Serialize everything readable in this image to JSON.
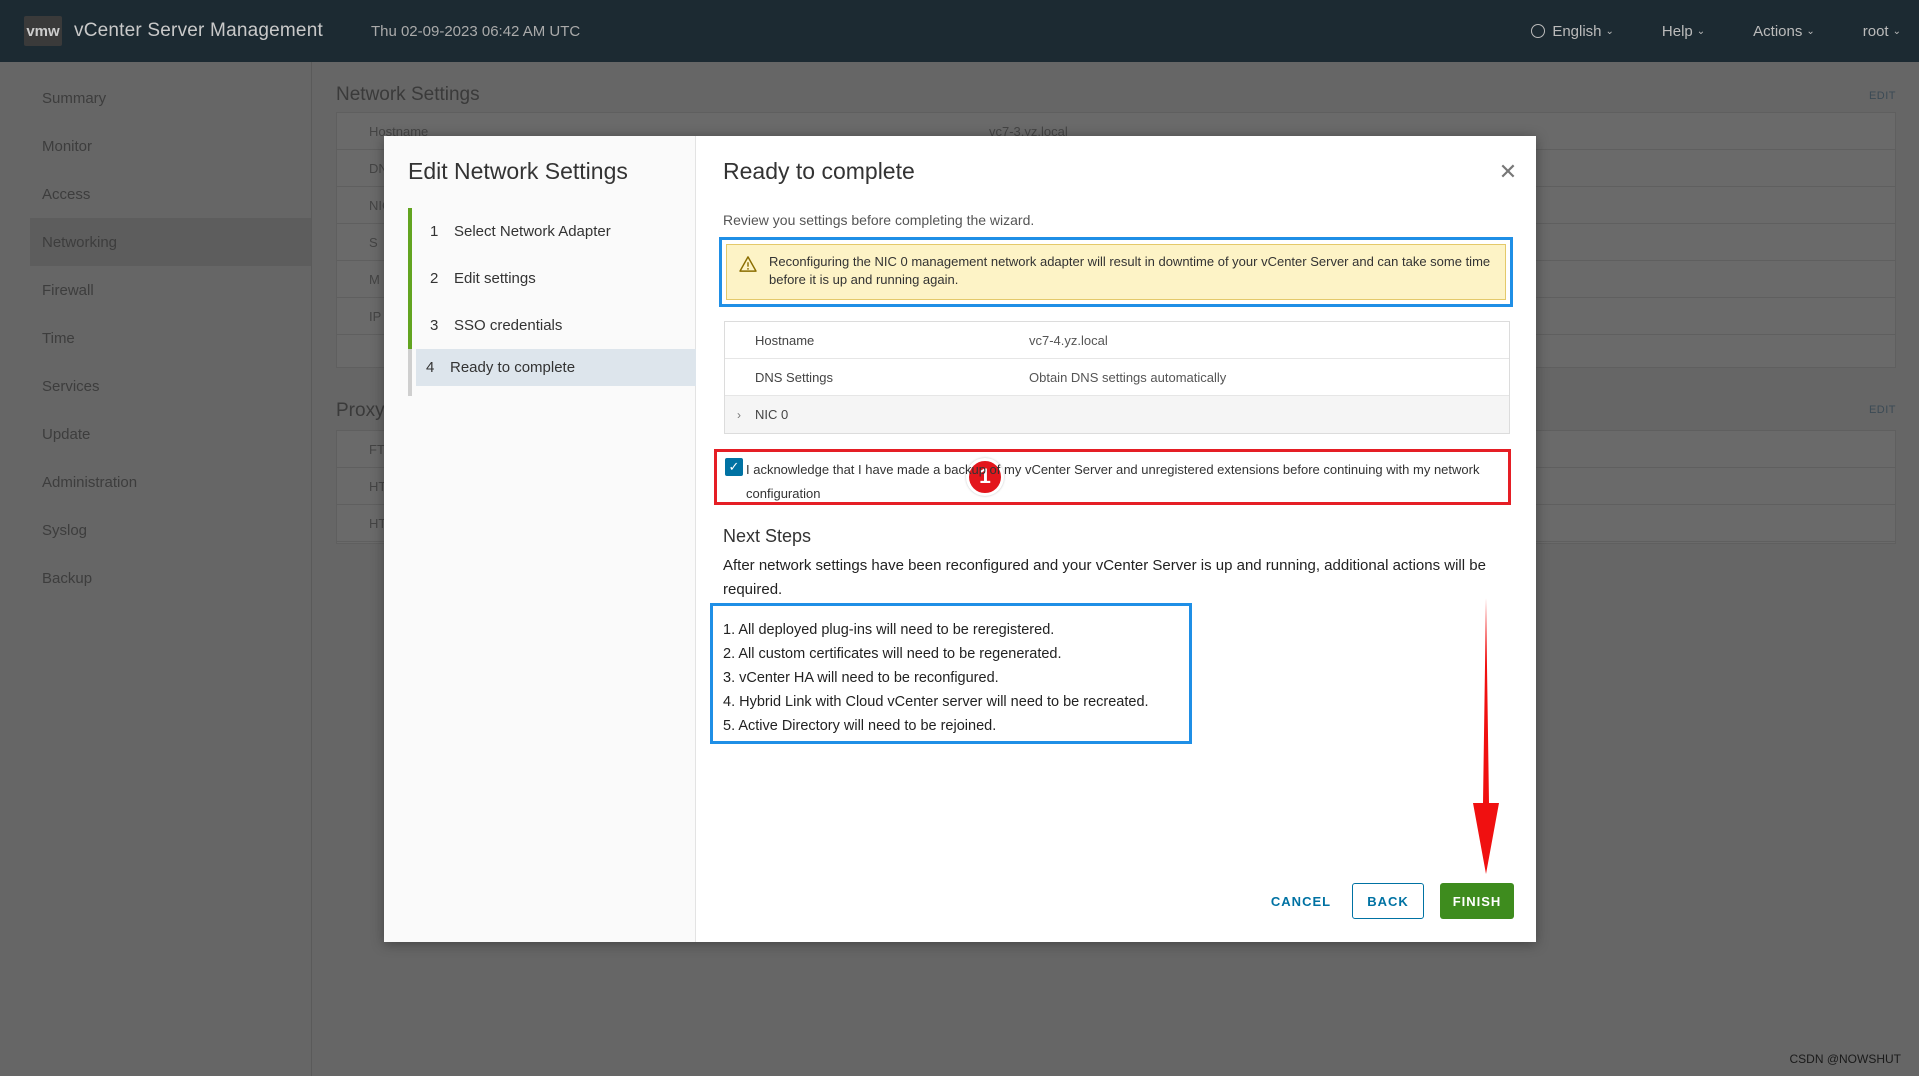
{
  "topbar": {
    "logo": "vmw",
    "title": "vCenter Server Management",
    "datetime": "Thu 02-09-2023 06:42 AM UTC",
    "language": "English",
    "help": "Help",
    "actions": "Actions",
    "user": "root"
  },
  "sidebar": {
    "items": [
      "Summary",
      "Monitor",
      "Access",
      "Networking",
      "Firewall",
      "Time",
      "Services",
      "Update",
      "Administration",
      "Syslog",
      "Backup"
    ],
    "active": "Networking"
  },
  "main": {
    "network_title": "Network Settings",
    "network_edit": "EDIT",
    "network_rows": [
      "Hostname",
      "DNS",
      "NIC",
      "S",
      "M",
      "IP",
      "IP"
    ],
    "network_hostname_value": "vc7-3.yz.local",
    "proxy_title": "Proxy Settings",
    "proxy_edit": "EDIT",
    "proxy_rows": [
      "FTP",
      "HTTP",
      "HTTPS"
    ]
  },
  "modal": {
    "title": "Edit Network Settings",
    "steps": [
      {
        "num": "1",
        "label": "Select Network Adapter"
      },
      {
        "num": "2",
        "label": "Edit settings"
      },
      {
        "num": "3",
        "label": "SSO credentials"
      },
      {
        "num": "4",
        "label": "Ready to complete"
      }
    ],
    "content_title": "Ready to complete",
    "review_text": "Review you settings before completing the wizard.",
    "warning": "Reconfiguring the NIC 0 management network adapter will result in downtime of your vCenter Server and can take some time before it is up and running again.",
    "summary": {
      "hostname_label": "Hostname",
      "hostname_value": "vc7-4.yz.local",
      "dns_label": "DNS Settings",
      "dns_value": "Obtain DNS settings automatically",
      "nic_label": "NIC 0"
    },
    "ack_text": "I acknowledge that I have made a backup of my vCenter Server and unregistered extensions before continuing with my network configuration",
    "ack_checked": true,
    "badge": "1",
    "next_steps_title": "Next Steps",
    "next_steps_desc": "After network settings have been reconfigured and your vCenter Server is up and running, additional actions will be required.",
    "next_steps": [
      "1. All deployed plug-ins will need to be reregistered.",
      "2. All custom certificates will need to be regenerated.",
      "3. vCenter HA will need to be reconfigured.",
      "4. Hybrid Link with Cloud vCenter server will need to be recreated.",
      "5. Active Directory will need to be rejoined."
    ],
    "buttons": {
      "cancel": "CANCEL",
      "back": "BACK",
      "finish": "FINISH"
    }
  },
  "credit": "CSDN @NOWSHUT",
  "colors": {
    "accent_blue": "#0072a3",
    "finish_green": "#3e8c1e",
    "step_green": "#62a420",
    "annotation_red": "#e51e25",
    "annotation_blue": "#1f8fe6",
    "warning_bg": "#fdf3c6"
  }
}
